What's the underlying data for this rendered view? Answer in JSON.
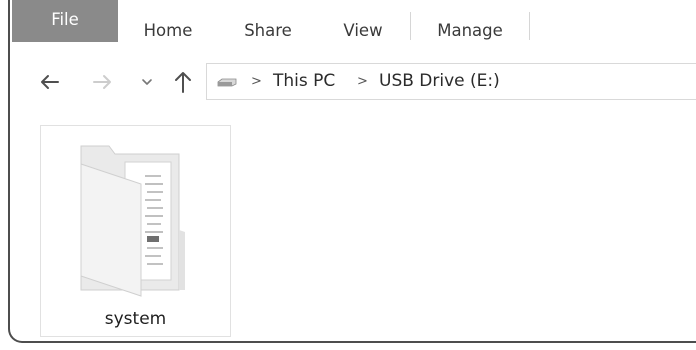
{
  "ribbon": {
    "tabs": [
      {
        "label": "File"
      },
      {
        "label": "Home"
      },
      {
        "label": "Share"
      },
      {
        "label": "View"
      },
      {
        "label": "Manage"
      }
    ]
  },
  "nav": {
    "back_icon": "left-arrow-icon",
    "forward_icon": "right-arrow-icon",
    "recent_icon": "chevron-down-icon",
    "up_icon": "up-arrow-icon"
  },
  "address": {
    "drive_icon": "usb-drive-icon",
    "crumbs": [
      {
        "label": "This PC"
      },
      {
        "label": "USB Drive (E:)"
      }
    ]
  },
  "items": [
    {
      "name": "system",
      "icon": "folder-icon"
    }
  ],
  "colors": {
    "file_tab_bg": "#8a8a8a",
    "file_tab_text": "#ffffff",
    "text": "#3a3a3a"
  }
}
